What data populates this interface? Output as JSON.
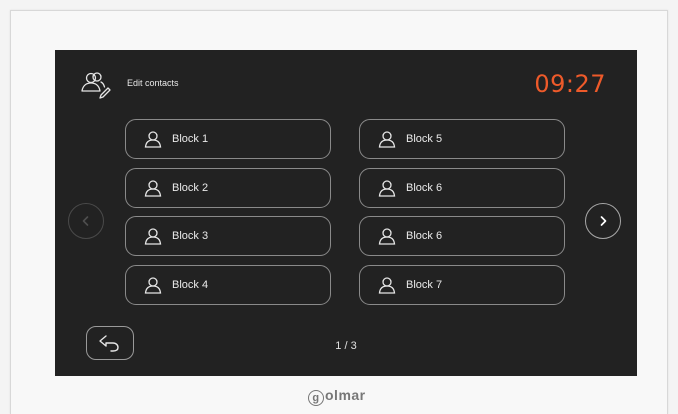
{
  "header": {
    "title": "Edit contacts",
    "time": "09:27"
  },
  "contacts": [
    {
      "label": "Block 1"
    },
    {
      "label": "Block 2"
    },
    {
      "label": "Block 3"
    },
    {
      "label": "Block 4"
    },
    {
      "label": "Block 5"
    },
    {
      "label": "Block 6"
    },
    {
      "label": "Block 6"
    },
    {
      "label": "Block 7"
    }
  ],
  "pagination": {
    "indicator": "1 / 3"
  },
  "brand": {
    "g": "g",
    "rest": "olmar"
  },
  "icons": {
    "header": "edit-contacts-icon",
    "contact": "person-icon",
    "prev": "chevron-left-icon",
    "next": "chevron-right-icon",
    "back": "back-arrow-icon"
  },
  "colors": {
    "clock": "#ee5a2a",
    "screen": "#222222",
    "border": "#8a8a8a"
  }
}
